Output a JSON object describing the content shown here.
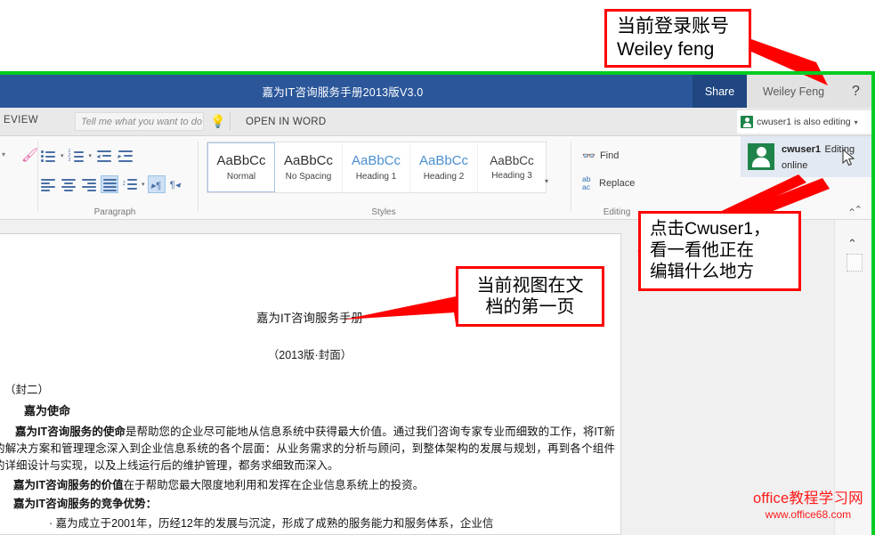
{
  "app": {
    "title": "嘉为IT咨询服务手册2013版V3.0",
    "share_label": "Share",
    "account_name": "Weiley Feng",
    "help_label": "?",
    "frame_color": "#00cc22",
    "titlebar_color": "#2b579a"
  },
  "tabrow": {
    "tab_review": "EVIEW",
    "tellme_placeholder": "Tell me what you want to do",
    "tellme_value": "",
    "bulb_icon": "lightbulb-icon",
    "open_in_word": "OPEN IN WORD"
  },
  "collab_strip": {
    "text": "cwuser1 is also editing",
    "caret": "▾",
    "avatar_icon": "person-icon"
  },
  "collab_card": {
    "name": "cwuser1",
    "status": "Editing online",
    "avatar_icon": "person-icon",
    "cursor_icon": "mouse-pointer-icon"
  },
  "ribbon": {
    "groups": [
      {
        "name": "Paragraph",
        "label": "Paragraph"
      },
      {
        "name": "Styles",
        "label": "Styles"
      },
      {
        "name": "Editing",
        "label": "Editing"
      }
    ],
    "paragraph": {
      "row1": [
        "bullet-list-icon",
        "numbered-list-icon",
        "decrease-indent-icon",
        "increase-indent-icon"
      ],
      "row2": [
        "align-left-icon",
        "align-center-icon",
        "align-right-icon",
        "justify-icon",
        "line-spacing-icon",
        "ltr-text-icon",
        "rtl-text-icon"
      ]
    },
    "styles": [
      {
        "preview": "AaBbCc",
        "name": "Normal",
        "variant": "normal",
        "active": true
      },
      {
        "preview": "AaBbCc",
        "name": "No Spacing",
        "variant": "normal",
        "active": false
      },
      {
        "preview": "AaBbCc",
        "name": "Heading 1",
        "variant": "blue",
        "active": false
      },
      {
        "preview": "AaBbCc",
        "name": "Heading 2",
        "variant": "blue",
        "active": false
      },
      {
        "preview": "AaBbCc",
        "name": "Heading 3",
        "variant": "h3",
        "active": false
      }
    ],
    "gallery_more": "▾",
    "editing": {
      "find_label": "Find",
      "find_icon": "binoculars-icon",
      "replace_label": "Replace",
      "replace_icon": "ab-ac-icon"
    },
    "collapse_icon": "⌃"
  },
  "document": {
    "title": "嘉为IT咨询服务手册",
    "subtitle": "（2013版·封面）",
    "inside_cover": "（封二）",
    "heading": "嘉为使命",
    "mission_bold": "嘉为IT咨询服务的使命",
    "mission_rest": "是帮助您的企业尽可能地从信息系统中获得最大价值。通过我们咨询专家专业而细致的工作，将IT新的解决方案和管理理念深入到企业信息系统的各个层面：从业务需求的分析与顾问，到整体架构的发展与规划，再到各个组件的详细设计与实现，以及上线运行后的维护管理，都务求细致而深入。",
    "value_bold": "嘉为IT咨询服务的价值",
    "value_rest": "在于帮助您最大限度地利用和发挥在企业信息系统上的投资。",
    "advantage_bold": "嘉为IT咨询服务的竞争优势：",
    "bullet1": "· 嘉为成立于2001年，历经12年的发展与沉淀，形成了成熟的服务能力和服务体系，企业信"
  },
  "scrollbar": {
    "up_arrow_outer": "⌃",
    "up_arrow_inner": "⌃",
    "thumb_icon": "scroll-thumb"
  },
  "annotations": {
    "account": {
      "line1": "当前登录账号",
      "line2": "Weiley feng"
    },
    "page": {
      "line1": "当前视图在文",
      "line2": "档的第一页"
    },
    "click": {
      "line1": "点击Cwuser1，",
      "line2": "看一看他正在",
      "line3": "编辑什么地方"
    },
    "border_color": "#ff0000"
  },
  "watermark": {
    "line1": "office教程学习网",
    "line2": "www.office68.com",
    "color": "#ff1a1a"
  }
}
